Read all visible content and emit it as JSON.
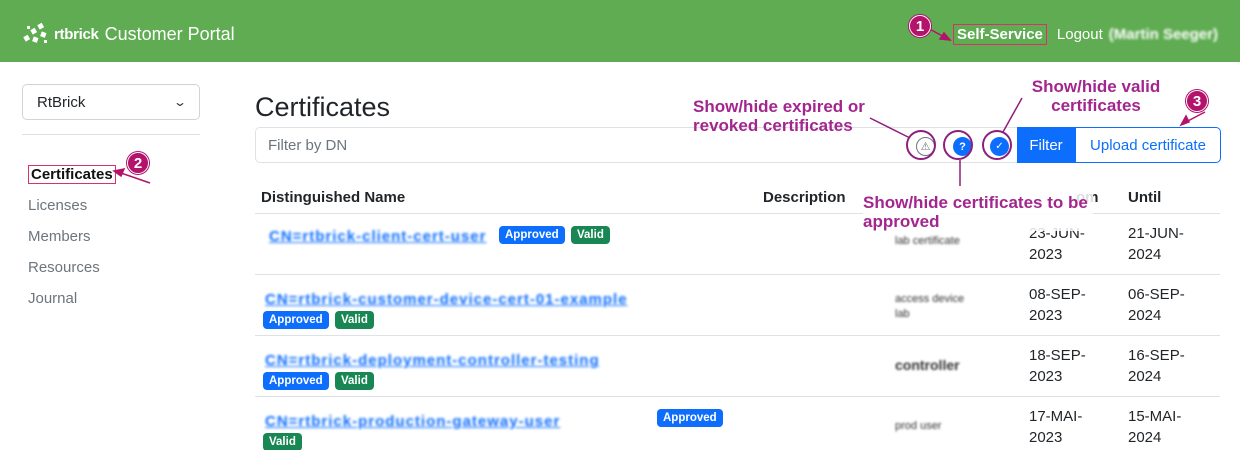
{
  "header": {
    "brand_name": "rtbrick",
    "portal_title": "Customer Portal",
    "self_service": "Self-Service",
    "logout": "Logout",
    "user": "(Martin Seeger)"
  },
  "sidebar": {
    "org_selected": "RtBrick",
    "items": [
      {
        "label": "Certificates",
        "active": true
      },
      {
        "label": "Licenses"
      },
      {
        "label": "Members"
      },
      {
        "label": "Resources"
      },
      {
        "label": "Journal"
      }
    ]
  },
  "main": {
    "title": "Certificates",
    "filter_placeholder": "Filter by DN",
    "filter_button": "Filter",
    "upload_button": "Upload certificate",
    "icons": {
      "expired": "warning-triangle-icon",
      "pending": "question-icon",
      "valid": "check-icon"
    }
  },
  "table": {
    "headers": {
      "dn": "Distinguished Name",
      "description": "Description",
      "from": "om",
      "until": "Until"
    },
    "rows": [
      {
        "dn": "CN=rtbrick-client-cert-user",
        "badges": [
          "Approved",
          "Valid"
        ],
        "description": "lab certificate",
        "from": "23-JUN-2023",
        "until": "21-JUN-2024"
      },
      {
        "dn": "CN=rtbrick-customer-device-cert-01-example",
        "badges": [
          "Approved",
          "Valid"
        ],
        "description": "access device lab",
        "from": "08-SEP-2023",
        "until": "06-SEP-2024"
      },
      {
        "dn": "CN=rtbrick-deployment-controller-testing",
        "badges": [
          "Approved",
          "Valid"
        ],
        "description": "controller",
        "from": "18-SEP-2023",
        "until": "16-SEP-2024"
      },
      {
        "dn": "CN=rtbrick-production-gateway-user",
        "badges": [
          "Approved",
          "Valid"
        ],
        "description": "prod user",
        "from": "17-MAI-2023",
        "until": "15-MAI-2024"
      }
    ]
  },
  "annotations": {
    "expired": "Show/hide expired or revoked certificates",
    "valid": "Show/hide valid certificates",
    "pending": "Show/hide certificates to be approved",
    "n1": "1",
    "n2": "2",
    "n3": "3"
  },
  "colors": {
    "header_bg": "#5fac52",
    "primary": "#0d6efd",
    "success": "#198754",
    "annotation": "#a3268f",
    "marker": "#b3136b"
  }
}
